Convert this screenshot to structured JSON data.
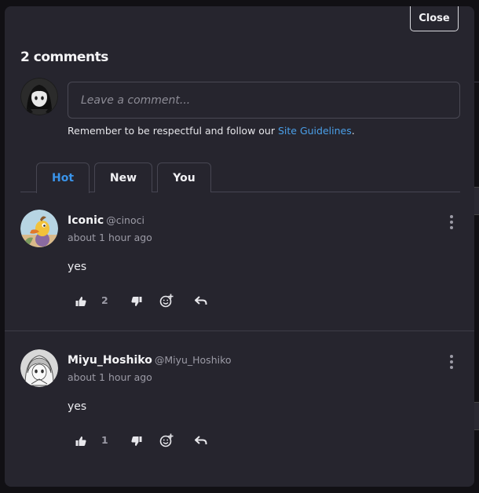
{
  "close_button": {
    "label": "Close"
  },
  "header": {
    "comment_count": "2 comments"
  },
  "composer": {
    "placeholder": "Leave a comment...",
    "guidelines_prefix": "Remember to be respectful and follow our ",
    "guidelines_link": "Site Guidelines",
    "guidelines_suffix": "."
  },
  "tabs": [
    {
      "label": "Hot",
      "active": true
    },
    {
      "label": "New",
      "active": false
    },
    {
      "label": "You",
      "active": false
    }
  ],
  "comments": [
    {
      "name": "Iconic",
      "handle": "@cinoci",
      "time": "about 1 hour ago",
      "text": "yes",
      "likes": "2",
      "avatar_icon": "duck-avatar-icon"
    },
    {
      "name": "Miyu_Hoshiko",
      "handle": "@Miyu_Hoshiko",
      "time": "about 1 hour ago",
      "text": "yes",
      "likes": "1",
      "avatar_icon": "anime-girl-avatar-icon"
    }
  ],
  "colors": {
    "accent": "#3a94ea",
    "panel": "#26252e",
    "border": "#474652"
  }
}
